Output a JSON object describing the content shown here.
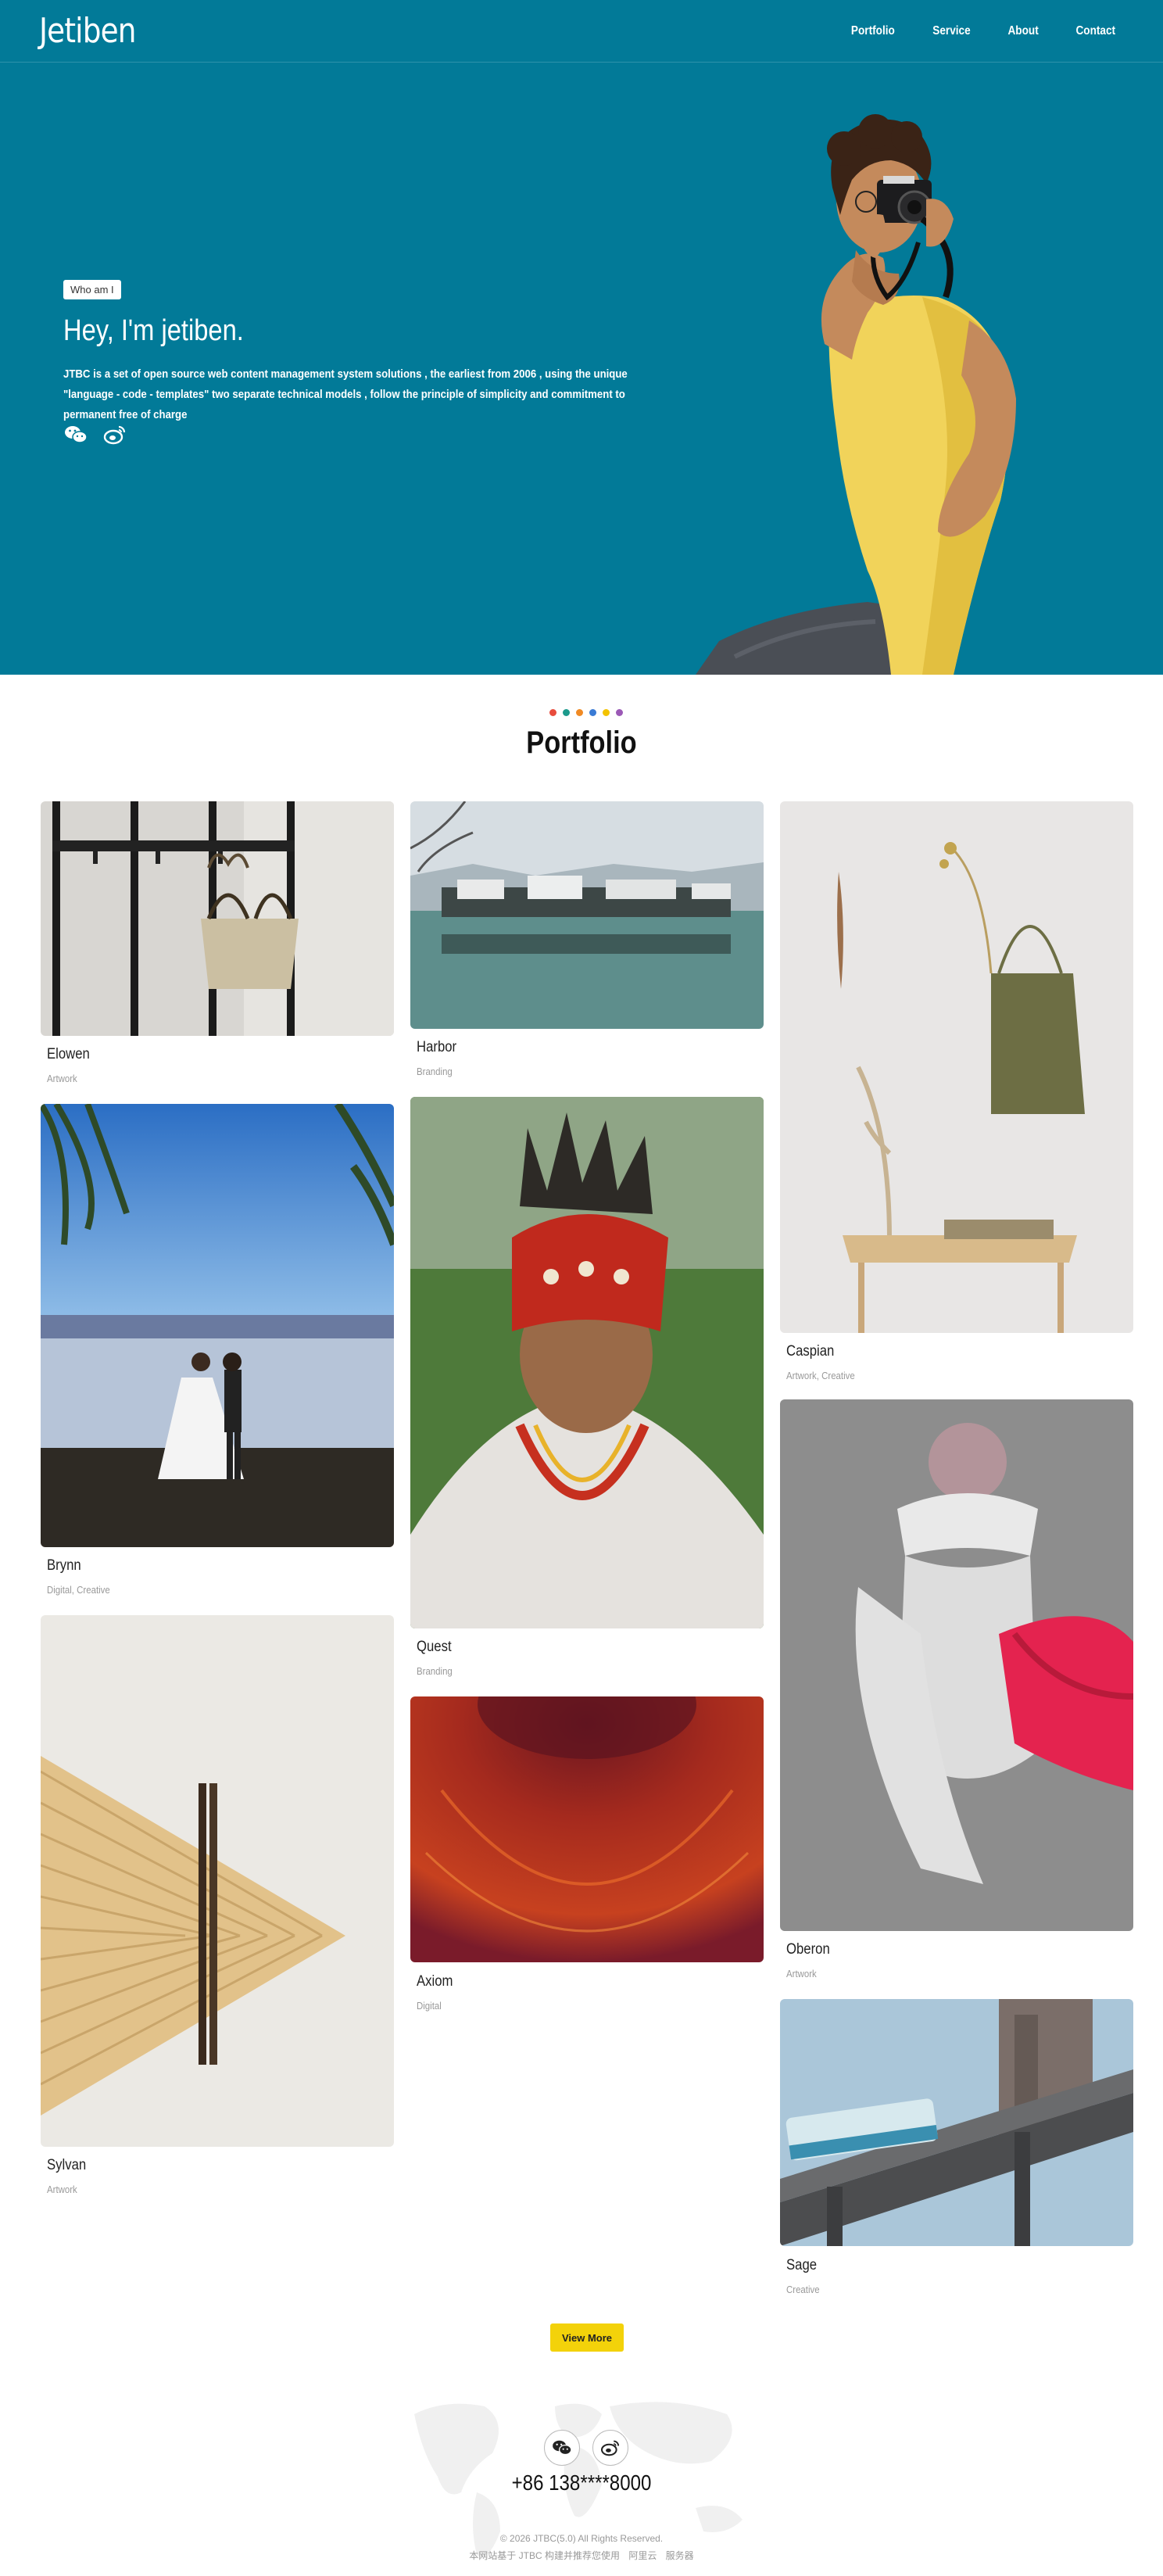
{
  "header": {
    "logo": "Jetiben",
    "nav": [
      "Portfolio",
      "Service",
      "About",
      "Contact"
    ]
  },
  "hero": {
    "badge": "Who am I",
    "title": "Hey, I'm jetiben.",
    "description": "JTBC is a set of open source web content management system solutions , the earliest from 2006 , using the unique \"language - code - templates\" two separate technical models , follow the principle of simplicity and commitment to permanent free of charge",
    "social_icons": [
      "wechat-icon",
      "weibo-icon"
    ],
    "background_color": "#027a98"
  },
  "portfolio": {
    "title": "Portfolio",
    "dot_colors": [
      "#e84c3d",
      "#1c9a8c",
      "#f08a24",
      "#3a7bd5",
      "#f3c300",
      "#9b59b6"
    ],
    "items": [
      {
        "name": "Elowen",
        "tag": "Artwork"
      },
      {
        "name": "Harbor",
        "tag": "Branding"
      },
      {
        "name": "Caspian",
        "tag": "Artwork, Creative"
      },
      {
        "name": "Brynn",
        "tag": "Digital, Creative"
      },
      {
        "name": "Quest",
        "tag": "Branding"
      },
      {
        "name": "Oberon",
        "tag": "Artwork"
      },
      {
        "name": "Sylvan",
        "tag": "Artwork"
      },
      {
        "name": "Axiom",
        "tag": "Digital"
      },
      {
        "name": "Sage",
        "tag": "Creative"
      }
    ],
    "view_more": "View More",
    "accent_color": "#f3d20a"
  },
  "footer": {
    "social_icons": [
      "wechat-icon",
      "weibo-icon"
    ],
    "phone": "+86 138****8000",
    "copyright": "© 2026 JTBC(5.0) All Rights Reserved.",
    "links": [
      "本网站基于 JTBC 构建并推荐您使用",
      "阿里云",
      "服务器"
    ]
  }
}
